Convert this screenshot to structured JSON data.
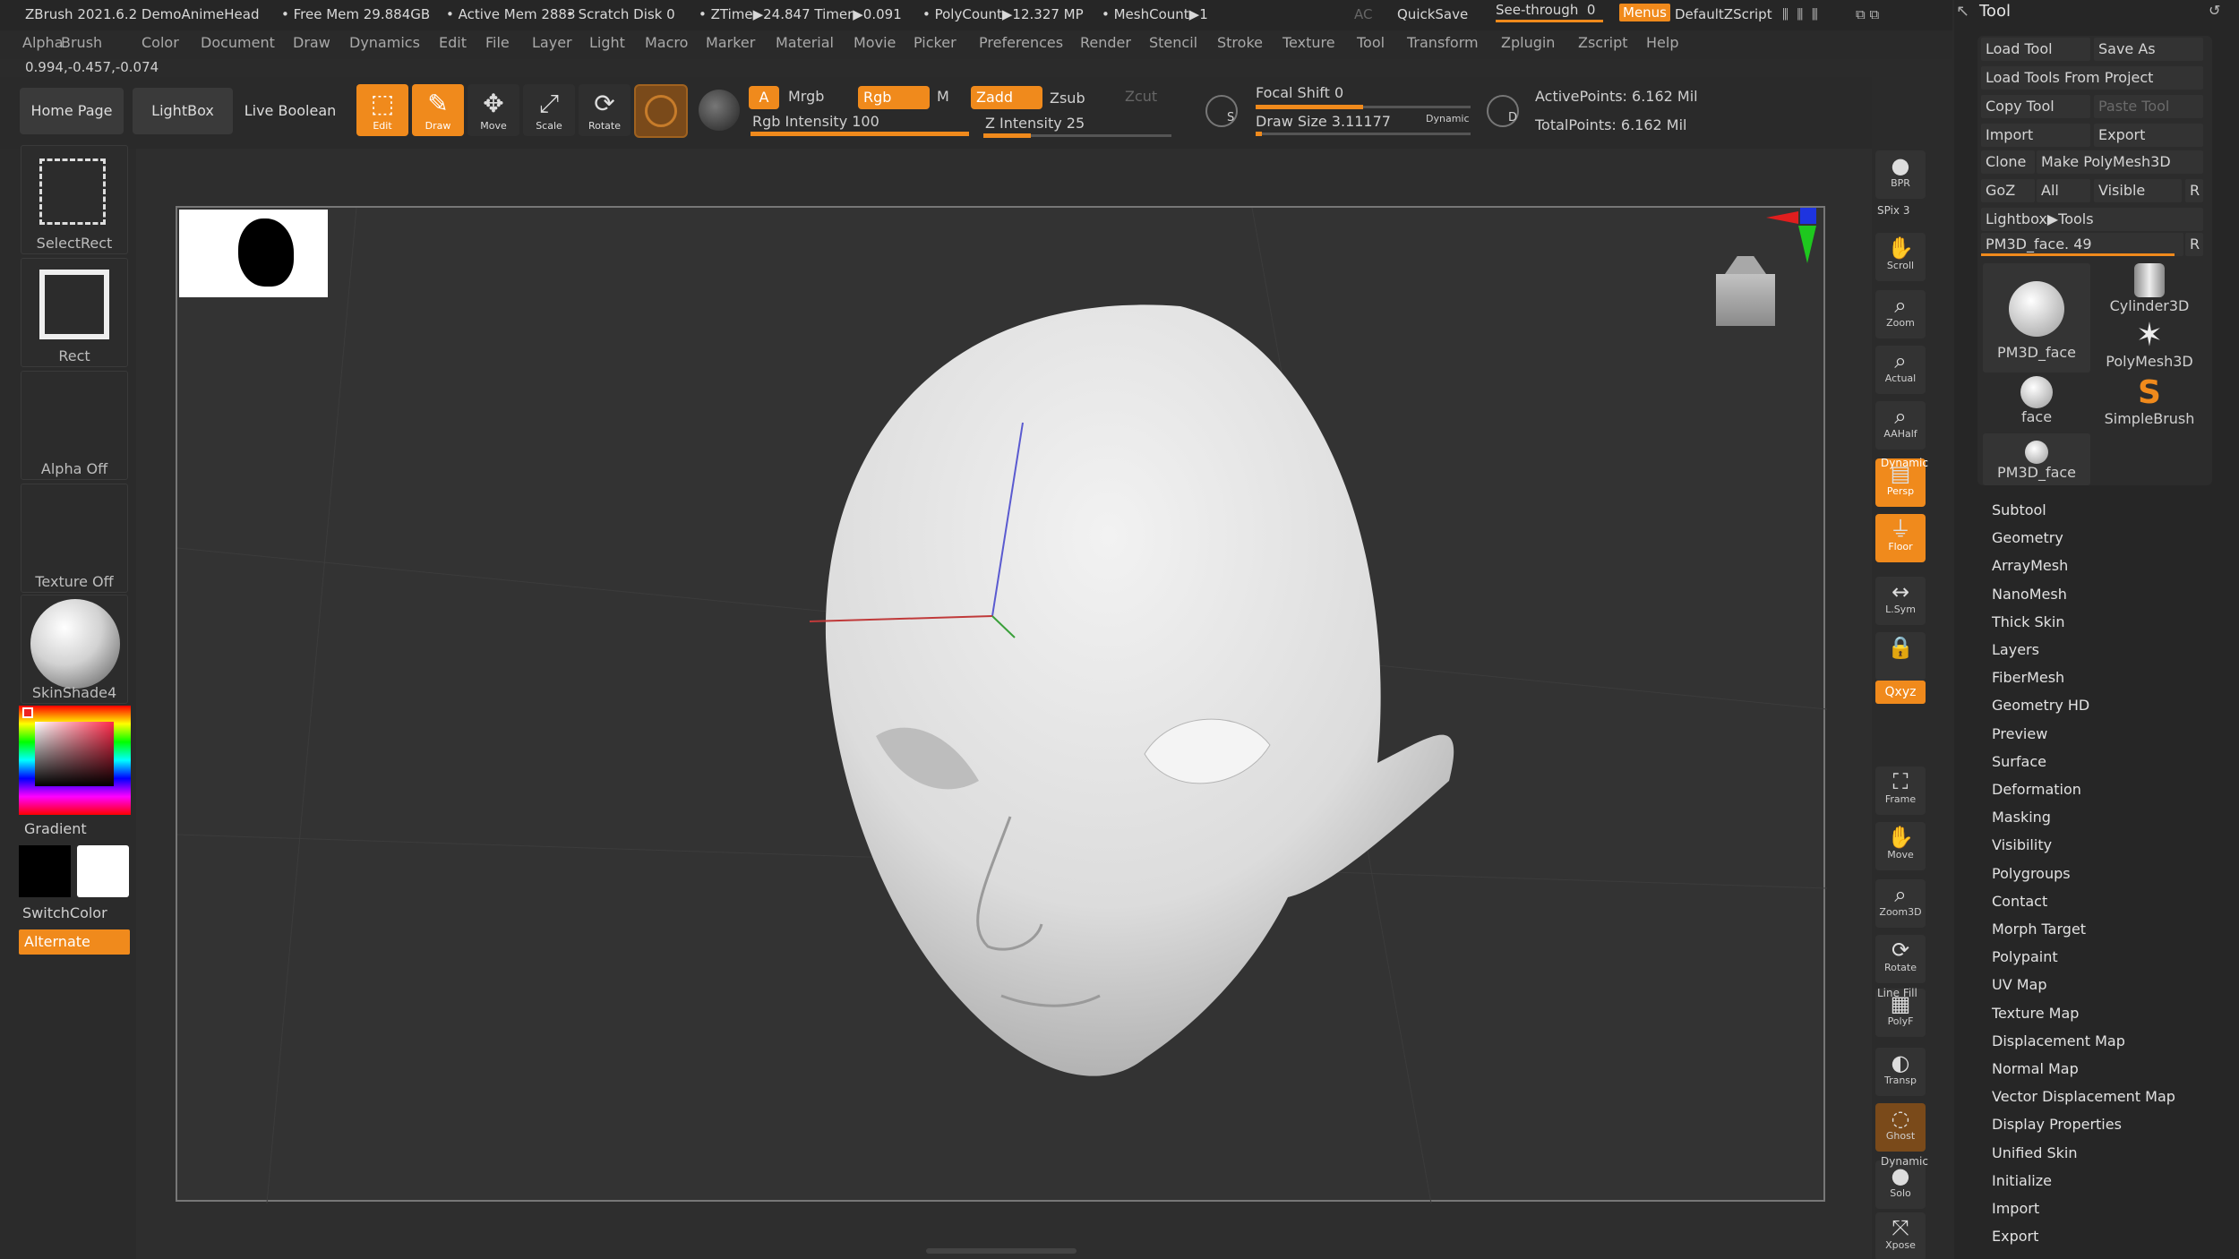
{
  "status_bar": {
    "app_title": "ZBrush 2021.6.2 DemoAnimeHead",
    "free_mem": "• Free Mem 29.884GB",
    "active_mem": "• Active Mem 2883",
    "scratch_disk": "• Scratch Disk 0",
    "ztime": "• ZTime▶24.847 Timer▶0.091",
    "polycount": "• PolyCount▶12.327 MP",
    "meshcount": "• MeshCount▶1",
    "ac_label": "AC",
    "quicksave_label": "QuickSave",
    "see_through_label": "See-through",
    "see_through_value": "0",
    "menus_label": "Menus",
    "script_label": "DefaultZScript"
  },
  "menu_bar": [
    "Alpha",
    "Brush",
    "Color",
    "Document",
    "Draw",
    "Dynamics",
    "Edit",
    "File",
    "Layer",
    "Light",
    "Macro",
    "Marker",
    "Material",
    "Movie",
    "Picker",
    "Preferences",
    "Render",
    "Stencil",
    "Stroke",
    "Texture",
    "Tool",
    "Transform",
    "Zplugin",
    "Zscript",
    "Help"
  ],
  "coordinates": "0.994,-0.457,-0.074",
  "shelf": {
    "home_page": "Home Page",
    "lightbox": "LightBox",
    "live_boolean": "Live Boolean",
    "edit": "Edit",
    "draw": "Draw",
    "move": "Move",
    "scale": "Scale",
    "rotate": "Rotate",
    "a_label": "A",
    "mrgb": "Mrgb",
    "rgb": "Rgb",
    "m": "M",
    "zadd": "Zadd",
    "zsub": "Zsub",
    "zcut": "Zcut",
    "rgb_intensity": "Rgb Intensity 100",
    "rgb_intensity_level": 1.0,
    "z_intensity": "Z Intensity 25",
    "z_intensity_level": 0.25,
    "focal_shift": "Focal Shift 0",
    "focal_shift_level": 0.5,
    "draw_size": "Draw Size 3.11177",
    "draw_size_level": 0.03,
    "dynamic": "Dynamic",
    "s_label": "S",
    "d_label": "D",
    "active_points": "ActivePoints: 6.162 Mil",
    "total_points": "TotalPoints: 6.162 Mil"
  },
  "left_tray": {
    "select_rect": "SelectRect",
    "rect": "Rect",
    "alpha_off": "Alpha Off",
    "texture_off": "Texture Off",
    "material": "SkinShade4",
    "gradient": "Gradient",
    "switch_color": "SwitchColor",
    "alternate": "Alternate"
  },
  "right_shelf": [
    {
      "icon": "bpr-icon",
      "label": "BPR",
      "glyph": "●"
    },
    {
      "icon": "scroll-icon",
      "label": "Scroll",
      "glyph": "✋"
    },
    {
      "icon": "zoom-icon",
      "label": "Zoom",
      "glyph": "⌕"
    },
    {
      "icon": "actual-icon",
      "label": "Actual",
      "glyph": "⌕"
    },
    {
      "icon": "aahalf-icon",
      "label": "AAHalf",
      "glyph": "⌕"
    },
    {
      "icon": "persp-icon",
      "label": "Persp",
      "glyph": "▤"
    },
    {
      "icon": "floor-icon",
      "label": "Floor",
      "glyph": "⏚"
    },
    {
      "icon": "lsym-icon",
      "label": "L.Sym",
      "glyph": "↔"
    },
    {
      "icon": "lock-icon",
      "label": "",
      "glyph": "🔒"
    },
    {
      "icon": "frame-icon",
      "label": "Frame",
      "glyph": "⛶"
    },
    {
      "icon": "move-icon",
      "label": "Move",
      "glyph": "✋"
    },
    {
      "icon": "zoom3d-icon",
      "label": "Zoom3D",
      "glyph": "⌕"
    },
    {
      "icon": "rotate-icon",
      "label": "Rotate",
      "glyph": "⟳"
    },
    {
      "icon": "polyf-icon",
      "label": "PolyF",
      "glyph": "▦"
    },
    {
      "icon": "transp-icon",
      "label": "Transp",
      "glyph": "◐"
    },
    {
      "icon": "ghost-icon",
      "label": "Ghost",
      "glyph": "◌"
    },
    {
      "icon": "solo-icon",
      "label": "Solo",
      "glyph": "●"
    },
    {
      "icon": "xpose-icon",
      "label": "Xpose",
      "glyph": "⤧"
    }
  ],
  "right_shelf_extra": {
    "spix": "SPix 3",
    "dynamic": "Dynamic",
    "xyz": "Qxyz",
    "line_fill": "Line Fill",
    "dynamic2": "Dynamic"
  },
  "tool_panel": {
    "title": "Tool",
    "load_tool": "Load Tool",
    "save_as": "Save As",
    "load_tools_from_project": "Load Tools From Project",
    "copy_tool": "Copy Tool",
    "paste_tool": "Paste Tool",
    "import": "Import",
    "export": "Export",
    "clone": "Clone",
    "make_polymesh": "Make PolyMesh3D",
    "goz": "GoZ",
    "all": "All",
    "visible": "Visible",
    "r": "R",
    "lightbox_tools": "Lightbox▶Tools",
    "current_tool": "PM3D_face. 49",
    "thumbs": [
      "PM3D_face",
      "Cylinder3D",
      "PolyMesh3D",
      "face",
      "SimpleBrush",
      "PM3D_face"
    ],
    "sections": [
      "Subtool",
      "Geometry",
      "ArrayMesh",
      "NanoMesh",
      "Thick Skin",
      "Layers",
      "FiberMesh",
      "Geometry HD",
      "Preview",
      "Surface",
      "Deformation",
      "Masking",
      "Visibility",
      "Polygroups",
      "Contact",
      "Morph Target",
      "Polypaint",
      "UV Map",
      "Texture Map",
      "Displacement Map",
      "Normal Map",
      "Vector Displacement Map",
      "Display Properties",
      "Unified Skin",
      "Initialize",
      "Import",
      "Export"
    ]
  },
  "colors": {
    "accent": "#f08a1c",
    "panel": "#262626",
    "canvas": "#333333"
  }
}
